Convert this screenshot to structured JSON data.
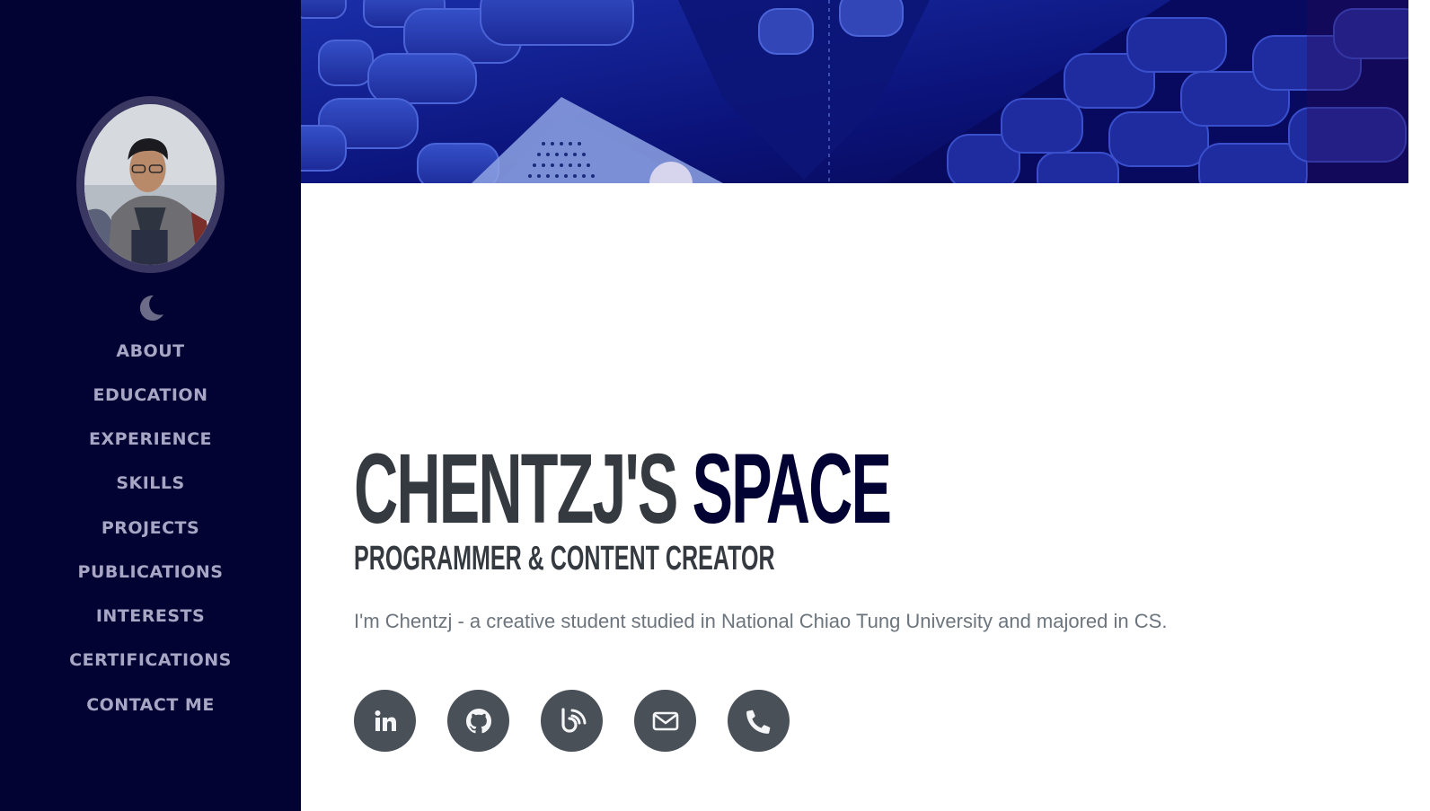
{
  "sidebar": {
    "theme_toggle_icon": "moon-icon",
    "nav": [
      {
        "label": "ABOUT"
      },
      {
        "label": "EDUCATION"
      },
      {
        "label": "EXPERIENCE"
      },
      {
        "label": "SKILLS"
      },
      {
        "label": "PROJECTS"
      },
      {
        "label": "PUBLICATIONS"
      },
      {
        "label": "INTERESTS"
      },
      {
        "label": "CERTIFICATIONS"
      },
      {
        "label": "CONTACT ME"
      }
    ]
  },
  "hero": {
    "title_part1": "CHENTZJ'S",
    "title_part2": "SPACE",
    "subtitle": "PROGRAMMER & CONTENT CREATOR",
    "lead": "I'm Chentzj - a creative student studied in National Chiao Tung University and majored in CS."
  },
  "social": [
    {
      "icon": "linkedin-icon"
    },
    {
      "icon": "github-icon"
    },
    {
      "icon": "blog-icon"
    },
    {
      "icon": "email-icon"
    },
    {
      "icon": "phone-icon"
    }
  ],
  "colors": {
    "sidebar_bg": "#020233",
    "nav_text": "#a7a6c4",
    "title_dark": "#343a40",
    "title_accent": "#020233",
    "icon_bg": "#495057"
  }
}
